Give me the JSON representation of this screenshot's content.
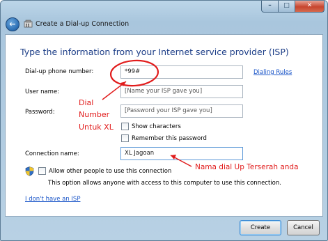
{
  "window": {
    "title": "Create a Dial-up Connection",
    "controls": {
      "minimize": "–",
      "maximize": "□",
      "close": "✕"
    }
  },
  "heading": "Type the information from your Internet service provider (ISP)",
  "form": {
    "phone_label": "Dial-up phone number:",
    "phone_value": "*99#",
    "dialing_rules": "Dialing Rules",
    "username_label": "User name:",
    "username_placeholder": "[Name your ISP gave you]",
    "password_label": "Password:",
    "password_placeholder": "[Password your ISP gave you]",
    "show_characters": "Show characters",
    "remember_password": "Remember this password",
    "connection_name_label": "Connection name:",
    "connection_name_value": "XL Jagoan",
    "allow_others": "Allow other people to use this connection",
    "allow_note": "This option allows anyone with access to this computer to use this connection.",
    "no_isp_link": "I don't have an ISP"
  },
  "buttons": {
    "create": "Create",
    "cancel": "Cancel"
  },
  "annotations": {
    "dial_number_line1": "Dial",
    "dial_number_line2": "Number",
    "dial_number_line3": "Untuk XL",
    "connection_name_note": "Nama dial Up Terserah anda"
  },
  "colors": {
    "annotation": "#e11b1b",
    "heading": "#1e3f88",
    "link": "#1a55c8"
  },
  "icons": [
    "back-arrow-icon",
    "phone-network-icon",
    "uac-shield-icon"
  ]
}
